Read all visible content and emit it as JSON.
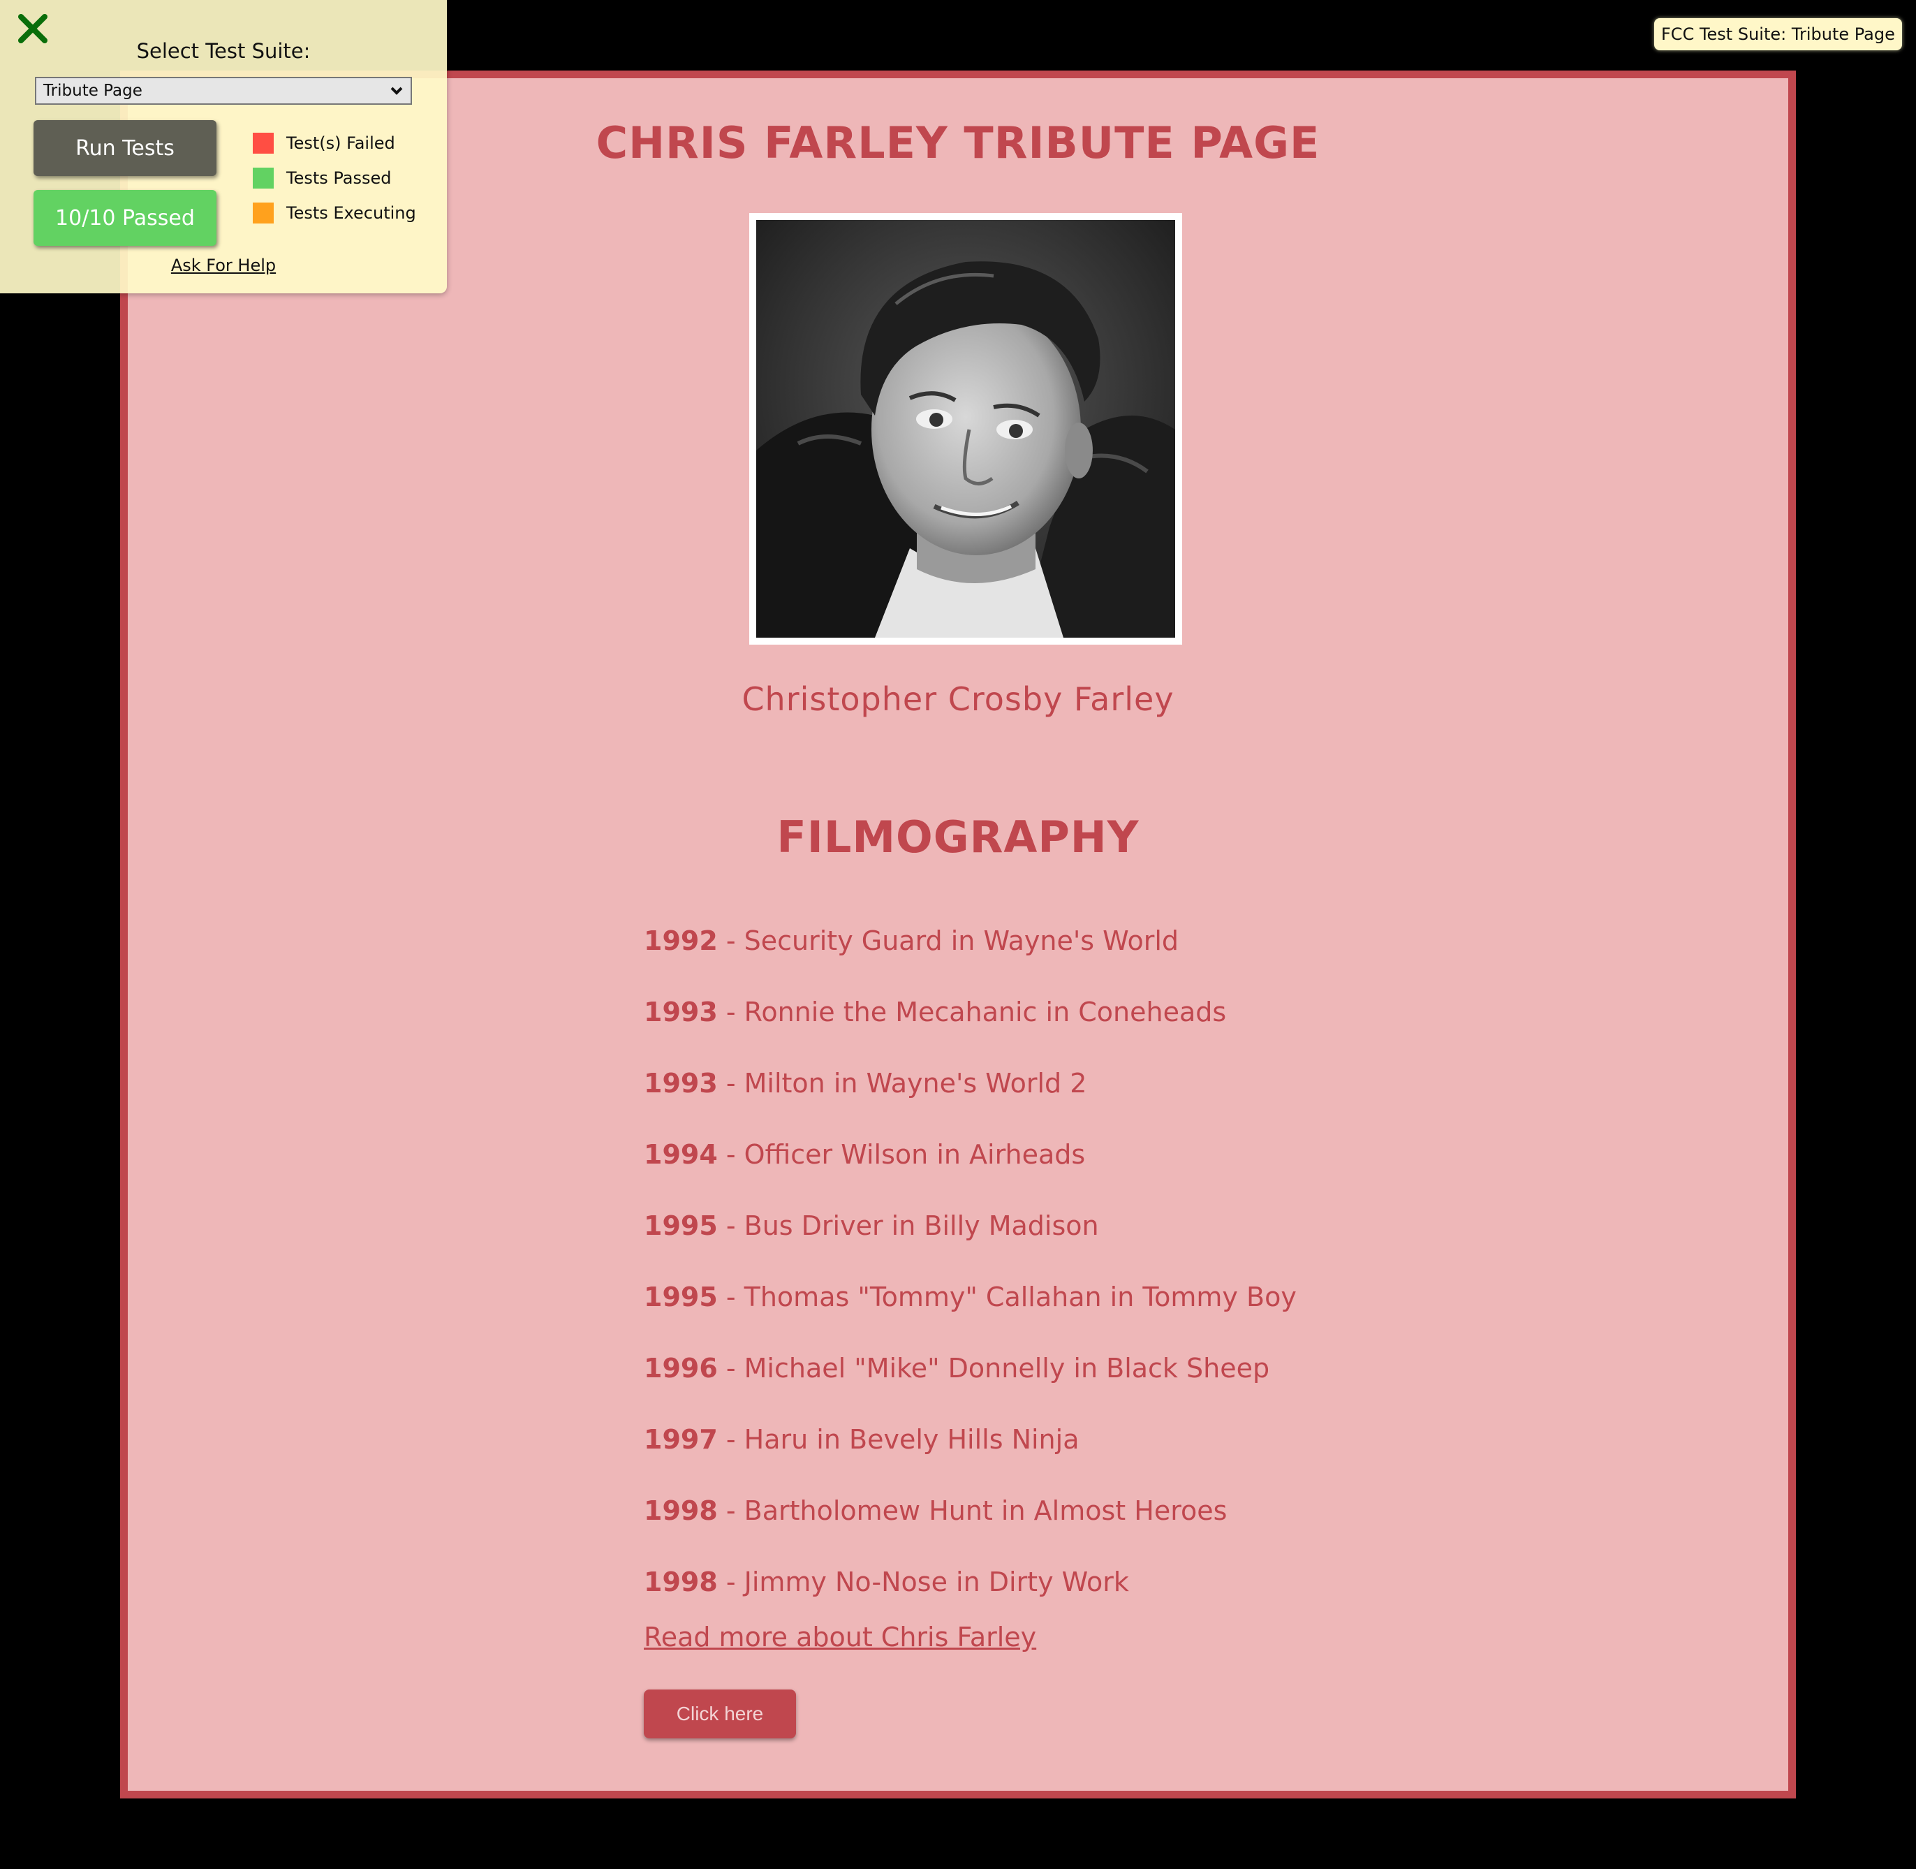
{
  "tribute": {
    "title": "CHRIS FARLEY TRIBUTE PAGE",
    "caption": "Christopher Crosby Farley",
    "filmography_title": "FILMOGRAPHY",
    "films": [
      {
        "year": "1992",
        "text": " - Security Guard in Wayne's World"
      },
      {
        "year": "1993",
        "text": " - Ronnie the Mecahanic in Coneheads"
      },
      {
        "year": "1993",
        "text": " - Milton in Wayne's World 2"
      },
      {
        "year": "1994",
        "text": " - Officer Wilson in Airheads"
      },
      {
        "year": "1995",
        "text": " - Bus Driver in Billy Madison"
      },
      {
        "year": "1995",
        "text": " - Thomas \"Tommy\" Callahan in Tommy Boy"
      },
      {
        "year": "1996",
        "text": " - Michael \"Mike\" Donnelly in Black Sheep"
      },
      {
        "year": "1997",
        "text": " - Haru in Bevely Hills Ninja"
      },
      {
        "year": "1998",
        "text": " - Bartholomew Hunt in Almost Heroes"
      },
      {
        "year": "1998",
        "text": " - Jimmy No-Nose in Dirty Work"
      }
    ],
    "read_more_link": "Read more about Chris Farley",
    "click_button": "Click here"
  },
  "fcc": {
    "select_label": "Select Test Suite:",
    "selected_suite": "Tribute Page",
    "run_button": "Run Tests",
    "result_button": "10/10 Passed",
    "legend": {
      "failed": "Test(s) Failed",
      "passed": "Tests Passed",
      "executing": "Tests Executing"
    },
    "ask_help": "Ask For Help",
    "badge": "FCC Test Suite: Tribute Page"
  },
  "icons": {
    "close": "close-icon",
    "dropdown": "chevron-down-icon"
  },
  "colors": {
    "page_background": "#000000",
    "tribute_background": "#eeb7b8",
    "accent": "#c0474e",
    "panel_background": "#fffac8",
    "run_button": "#5f5f54",
    "passed": "#62d262",
    "failed": "#ff4e43",
    "executing": "#ffa11d",
    "close_icon": "#0a6e0a"
  }
}
